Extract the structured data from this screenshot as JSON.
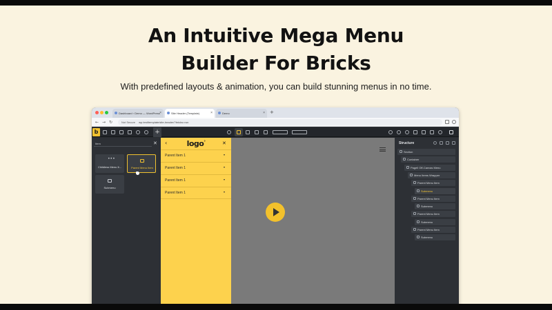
{
  "hero": {
    "title_line1": "An Intuitive Mega Menu",
    "title_line2": "Builder For Bricks",
    "subtitle": "With predefined layouts & animation, you can build stunning menus in no time."
  },
  "browser": {
    "tabs": [
      {
        "label": "Dashboard ‹ Demo — WordPress",
        "active": false
      },
      {
        "label": "Site Header (Template)",
        "active": true
      },
      {
        "label": "Demo",
        "active": false
      }
    ],
    "new_tab": "+",
    "security_label": "Not Secure",
    "url": "wp.test/template/site-header/?bricks=run"
  },
  "builder": {
    "logo": "b",
    "add_button": "+",
    "elements_search_placeholder": "Item",
    "close_label": "✕",
    "elements": [
      {
        "label": "Childless Menu It...",
        "icon": "dots-icon",
        "selected": false
      },
      {
        "label": "Parent Menu Item",
        "icon": "window-icon",
        "selected": true
      },
      {
        "label": "Submenu",
        "icon": "submenu-icon",
        "selected": false
      }
    ]
  },
  "canvas": {
    "logo_text": "logo",
    "logo_superscript": "°",
    "back_label": "‹",
    "close_label": "✕",
    "menu_items": [
      "Parent Item 1",
      "Parent Item 1",
      "Parent Item 1",
      "Parent Item 1"
    ],
    "chevron": "▾"
  },
  "structure": {
    "title": "Structure",
    "nodes": [
      {
        "label": "Section",
        "depth": 0,
        "highlight": false
      },
      {
        "label": "Container",
        "depth": 1,
        "highlight": false
      },
      {
        "label": "Pagell Off-Canvas Menu",
        "depth": 2,
        "highlight": false
      },
      {
        "label": "Menu Items Wrapper",
        "depth": 3,
        "highlight": false
      },
      {
        "label": "Parent Menu Item",
        "depth": 4,
        "highlight": false
      },
      {
        "label": "Submenu",
        "depth": 5,
        "highlight": true
      },
      {
        "label": "Parent Menu Item",
        "depth": 4,
        "highlight": false
      },
      {
        "label": "Submenu",
        "depth": 5,
        "highlight": false
      },
      {
        "label": "Parent Menu Item",
        "depth": 4,
        "highlight": false
      },
      {
        "label": "Submenu",
        "depth": 5,
        "highlight": false
      },
      {
        "label": "Parent Menu Item",
        "depth": 4,
        "highlight": false
      },
      {
        "label": "Submenu",
        "depth": 5,
        "highlight": false
      }
    ]
  },
  "colors": {
    "page_bg": "#faf3e0",
    "accent_yellow": "#fdd24d",
    "builder_dark": "#2d3035",
    "canvas_gray": "#7a7a7a"
  }
}
